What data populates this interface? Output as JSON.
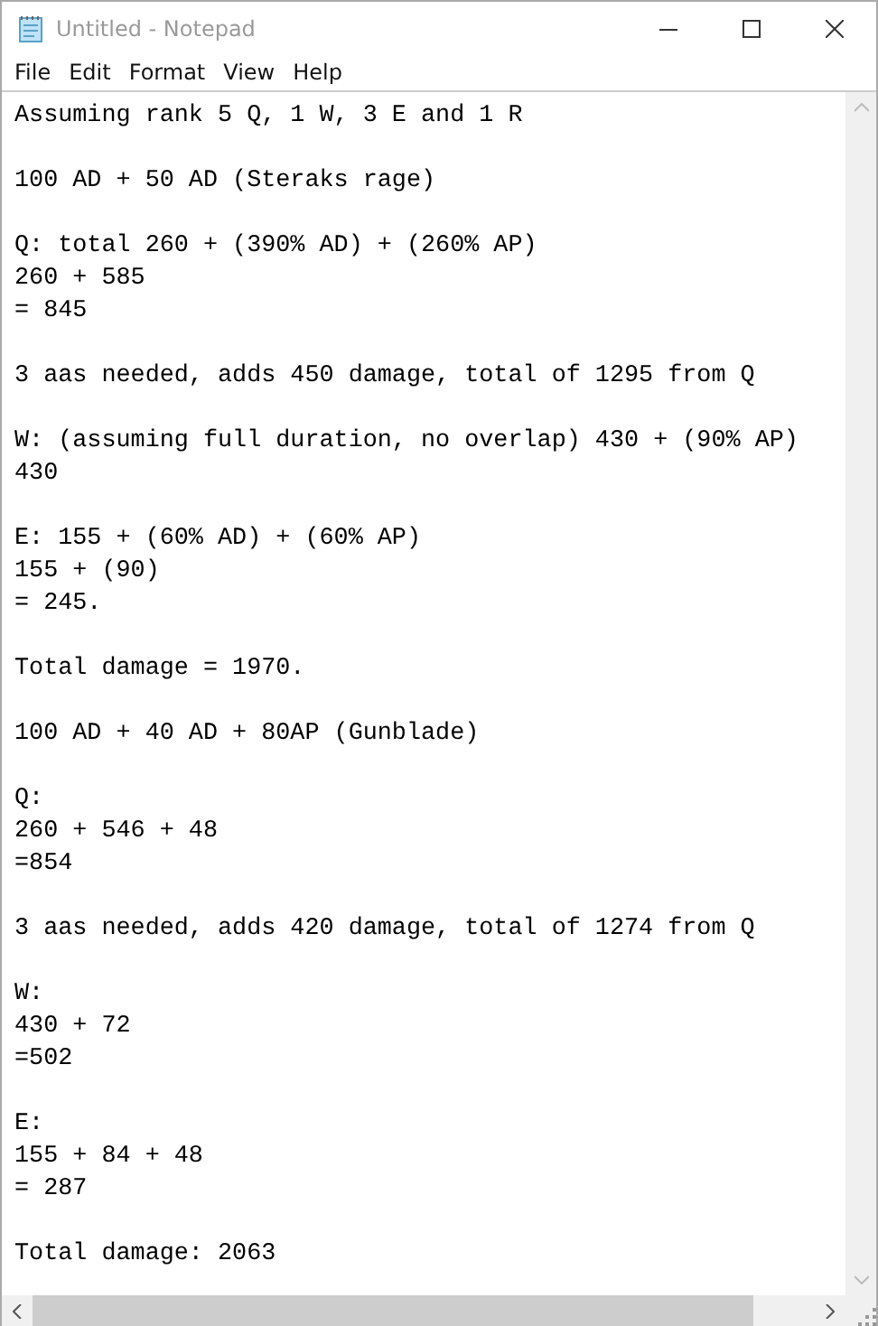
{
  "window": {
    "title": "Untitled - Notepad"
  },
  "menu": [
    {
      "label": "File"
    },
    {
      "label": "Edit"
    },
    {
      "label": "Format"
    },
    {
      "label": "View"
    },
    {
      "label": "Help"
    }
  ],
  "document": {
    "text": "Assuming rank 5 Q, 1 W, 3 E and 1 R\n\n100 AD + 50 AD (Steraks rage)\n\nQ: total 260 + (390% AD) + (260% AP)\n260 + 585\n= 845\n\n3 aas needed, adds 450 damage, total of 1295 from Q\n\nW: (assuming full duration, no overlap) 430 + (90% AP)\n430\n\nE: 155 + (60% AD) + (60% AP)\n155 + (90)\n= 245.\n\nTotal damage = 1970.\n\n100 AD + 40 AD + 80AP (Gunblade)\n\nQ:\n260 + 546 + 48\n=854\n\n3 aas needed, adds 420 damage, total of 1274 from Q\n\nW:\n430 + 72\n=502\n\nE:\n155 + 84 + 48\n= 287\n\nTotal damage: 2063"
  }
}
